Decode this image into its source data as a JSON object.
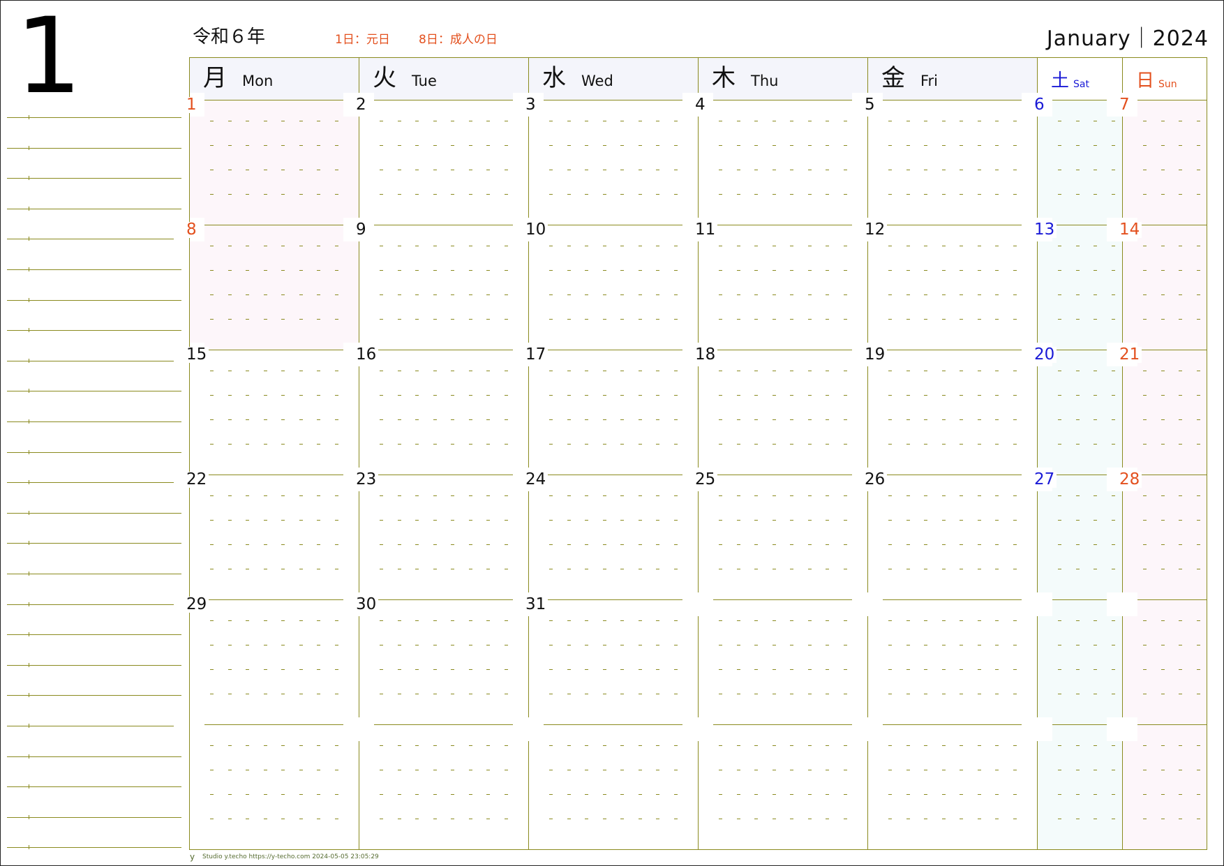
{
  "month_number": "1",
  "era_label": "令和６年",
  "month_en": "January｜2024",
  "holidays_notes": [
    "1日：元日",
    "8日：成人の日"
  ],
  "weekdays": [
    {
      "jp": "月",
      "en": "Mon"
    },
    {
      "jp": "火",
      "en": "Tue"
    },
    {
      "jp": "水",
      "en": "Wed"
    },
    {
      "jp": "木",
      "en": "Thu"
    },
    {
      "jp": "金",
      "en": "Fri"
    },
    {
      "jp": "土",
      "en": "Sat"
    },
    {
      "jp": "日",
      "en": "Sun"
    }
  ],
  "weeks": [
    [
      "1",
      "2",
      "3",
      "4",
      "5",
      "6",
      "7"
    ],
    [
      "8",
      "9",
      "10",
      "11",
      "12",
      "13",
      "14"
    ],
    [
      "15",
      "16",
      "17",
      "18",
      "19",
      "20",
      "21"
    ],
    [
      "22",
      "23",
      "24",
      "25",
      "26",
      "27",
      "28"
    ],
    [
      "29",
      "30",
      "31",
      "",
      "",
      "",
      ""
    ],
    [
      "",
      "",
      "",
      "",
      "",
      "",
      ""
    ]
  ],
  "holiday_dates": [
    "1",
    "8"
  ],
  "colors": {
    "grid": "#8a8a1e",
    "holiday": "#e3501e",
    "saturday": "#1a1ad6",
    "sunday": "#e3501e",
    "header_bg": "#f4f5fb",
    "sat_bg": "#f4fbfb",
    "sun_bg": "#fdf6fa",
    "holiday_bg": "#fdf6fa"
  },
  "footer": {
    "logo": "y",
    "text": "Studio y.techo   https://y-techo.com   2024-05-05 23:05:29"
  }
}
